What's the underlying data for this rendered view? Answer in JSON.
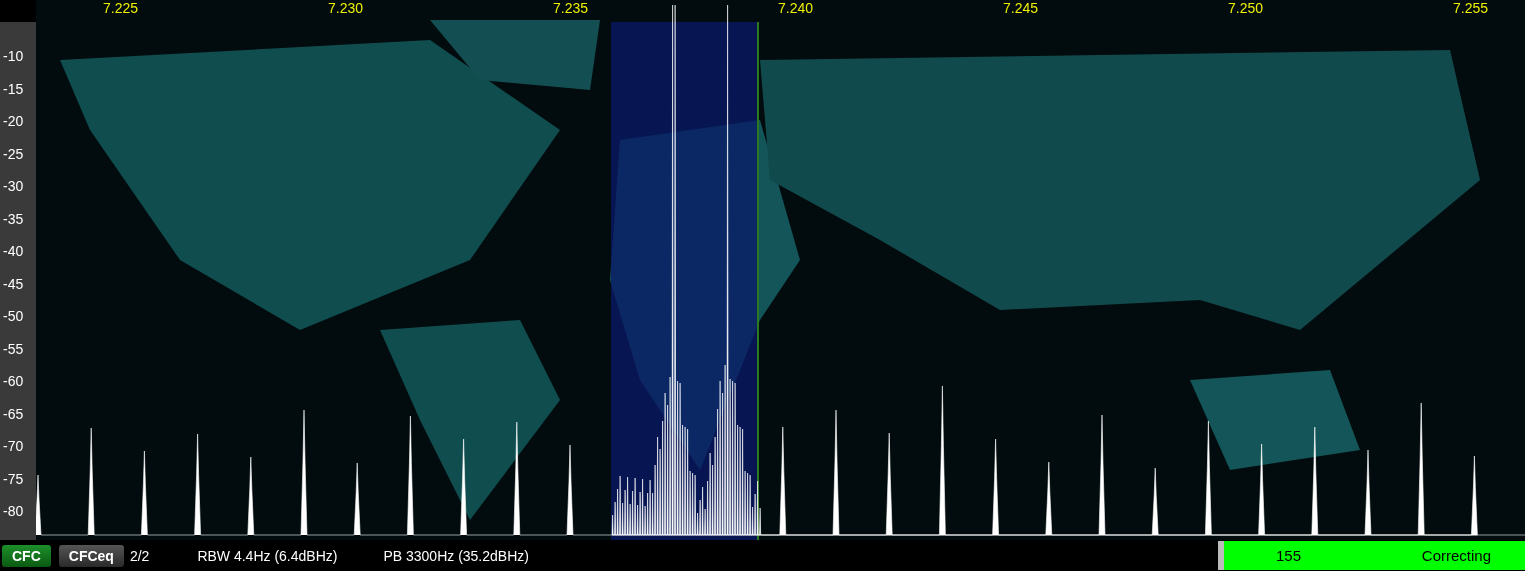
{
  "frequency_axis": [
    "7.225",
    "7.230",
    "7.235",
    "7.240",
    "7.245",
    "7.250",
    "7.255"
  ],
  "level_axis": [
    "-10",
    "-15",
    "-20",
    "-25",
    "-30",
    "-35",
    "-40",
    "-45",
    "-50",
    "-55",
    "-60",
    "-65",
    "-70",
    "-75",
    "-80"
  ],
  "status_bar": {
    "buttons": [
      {
        "label": "CFC",
        "selected": true
      },
      {
        "label": "CFCeq",
        "selected": false
      }
    ],
    "page": "2/2",
    "rbw": "RBW 4.4Hz (6.4dBHz)",
    "passband": "PB 3300Hz (35.2dBHz)",
    "indicator": {
      "value": "155",
      "status": "Correcting"
    }
  }
}
